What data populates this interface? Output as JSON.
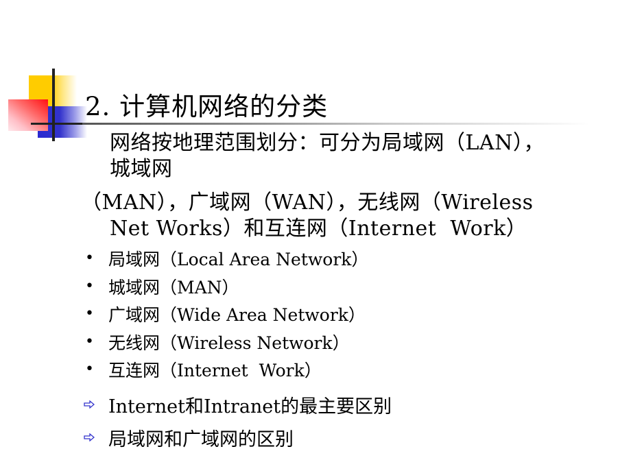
{
  "slide": {
    "title": "2. 计算机网络的分类",
    "paragraph_lines": [
      "网络按地理范围划分：可分为局域网（LAN），",
      "城域网",
      "（MAN），广域网（WAN），无线网（Wireless",
      "Net Works）和互连网（Internet  Work）"
    ],
    "bullets": [
      {
        "icon": "bullet-dot",
        "glyph": "•",
        "text": "局域网（Local Area Network）"
      },
      {
        "icon": "bullet-dot",
        "glyph": "•",
        "text": "城域网（MAN）"
      },
      {
        "icon": "bullet-dot",
        "glyph": "•",
        "text": "广域网（Wide Area Network）"
      },
      {
        "icon": "bullet-dot",
        "glyph": "•",
        "text": "无线网（Wireless Network）"
      },
      {
        "icon": "bullet-dot",
        "glyph": "•",
        "text": "互连网（Internet  Work）"
      }
    ],
    "arrow_items": [
      {
        "icon": "outline-right-arrow",
        "text": "Internet和Intranet的最主要区别"
      },
      {
        "icon": "outline-right-arrow",
        "text": "局域网和广域网的区别"
      }
    ],
    "colors": {
      "logo_yellow": "#ffcc00",
      "logo_red": "#ff1010",
      "logo_blue": "#2a2ad0",
      "arrow_blue": "#3333cc",
      "text": "#000000"
    }
  }
}
